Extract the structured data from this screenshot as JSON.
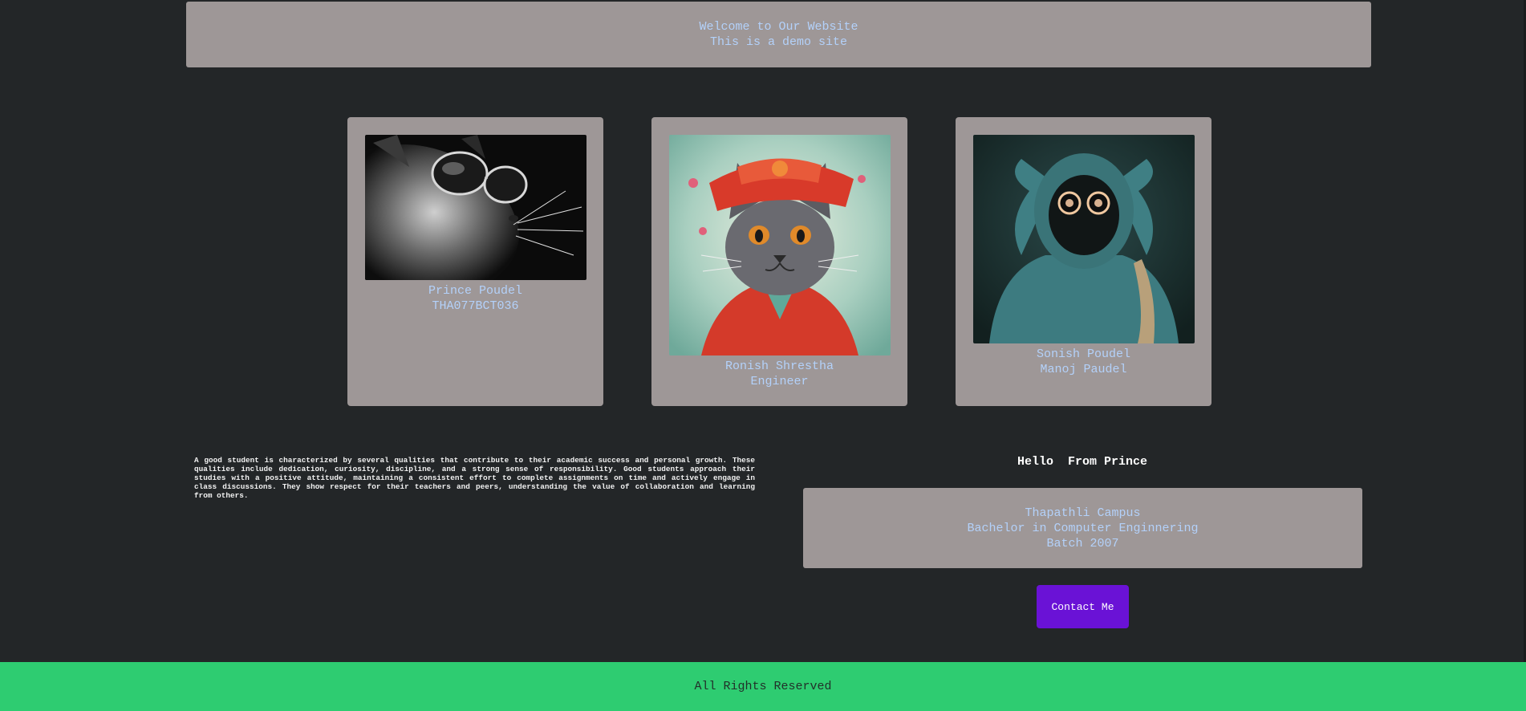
{
  "header": {
    "line1": "Welcome to Our Website",
    "line2": "This is a demo site"
  },
  "cards": [
    {
      "name": "Prince Poudel",
      "subtitle": "THA077BCT036",
      "image": "cat-with-sunglasses"
    },
    {
      "name": "Ronish Shrestha",
      "subtitle": "Engineer",
      "image": "cat-in-red-costume"
    },
    {
      "name": "Sonish Poudel",
      "subtitle": "Manoj Paudel",
      "image": "hooded-figure-glowing-eyes"
    }
  ],
  "paragraph": "A good student is characterized by several qualities that contribute to their academic success and personal growth. These qualities include dedication, curiosity, discipline, and a strong sense of responsibility. Good students approach their studies with a positive attitude, maintaining a consistent effort to complete assignments on time and actively engage in class discussions. They show respect for their teachers and peers, understanding the value of collaboration and learning from others.",
  "greeting": "Hello  From Prince",
  "campus": {
    "line1": "Thapathli Campus",
    "line2": "Bachelor in Computer Enginnering",
    "line3": "Batch 2007"
  },
  "contact_button": "Contact Me",
  "footer": "All Rights Reserved",
  "colors": {
    "background": "#232628",
    "box": "#9e9797",
    "box_text": "#b3d1fa",
    "button": "#6a12d6",
    "footer": "#2ecc71"
  }
}
